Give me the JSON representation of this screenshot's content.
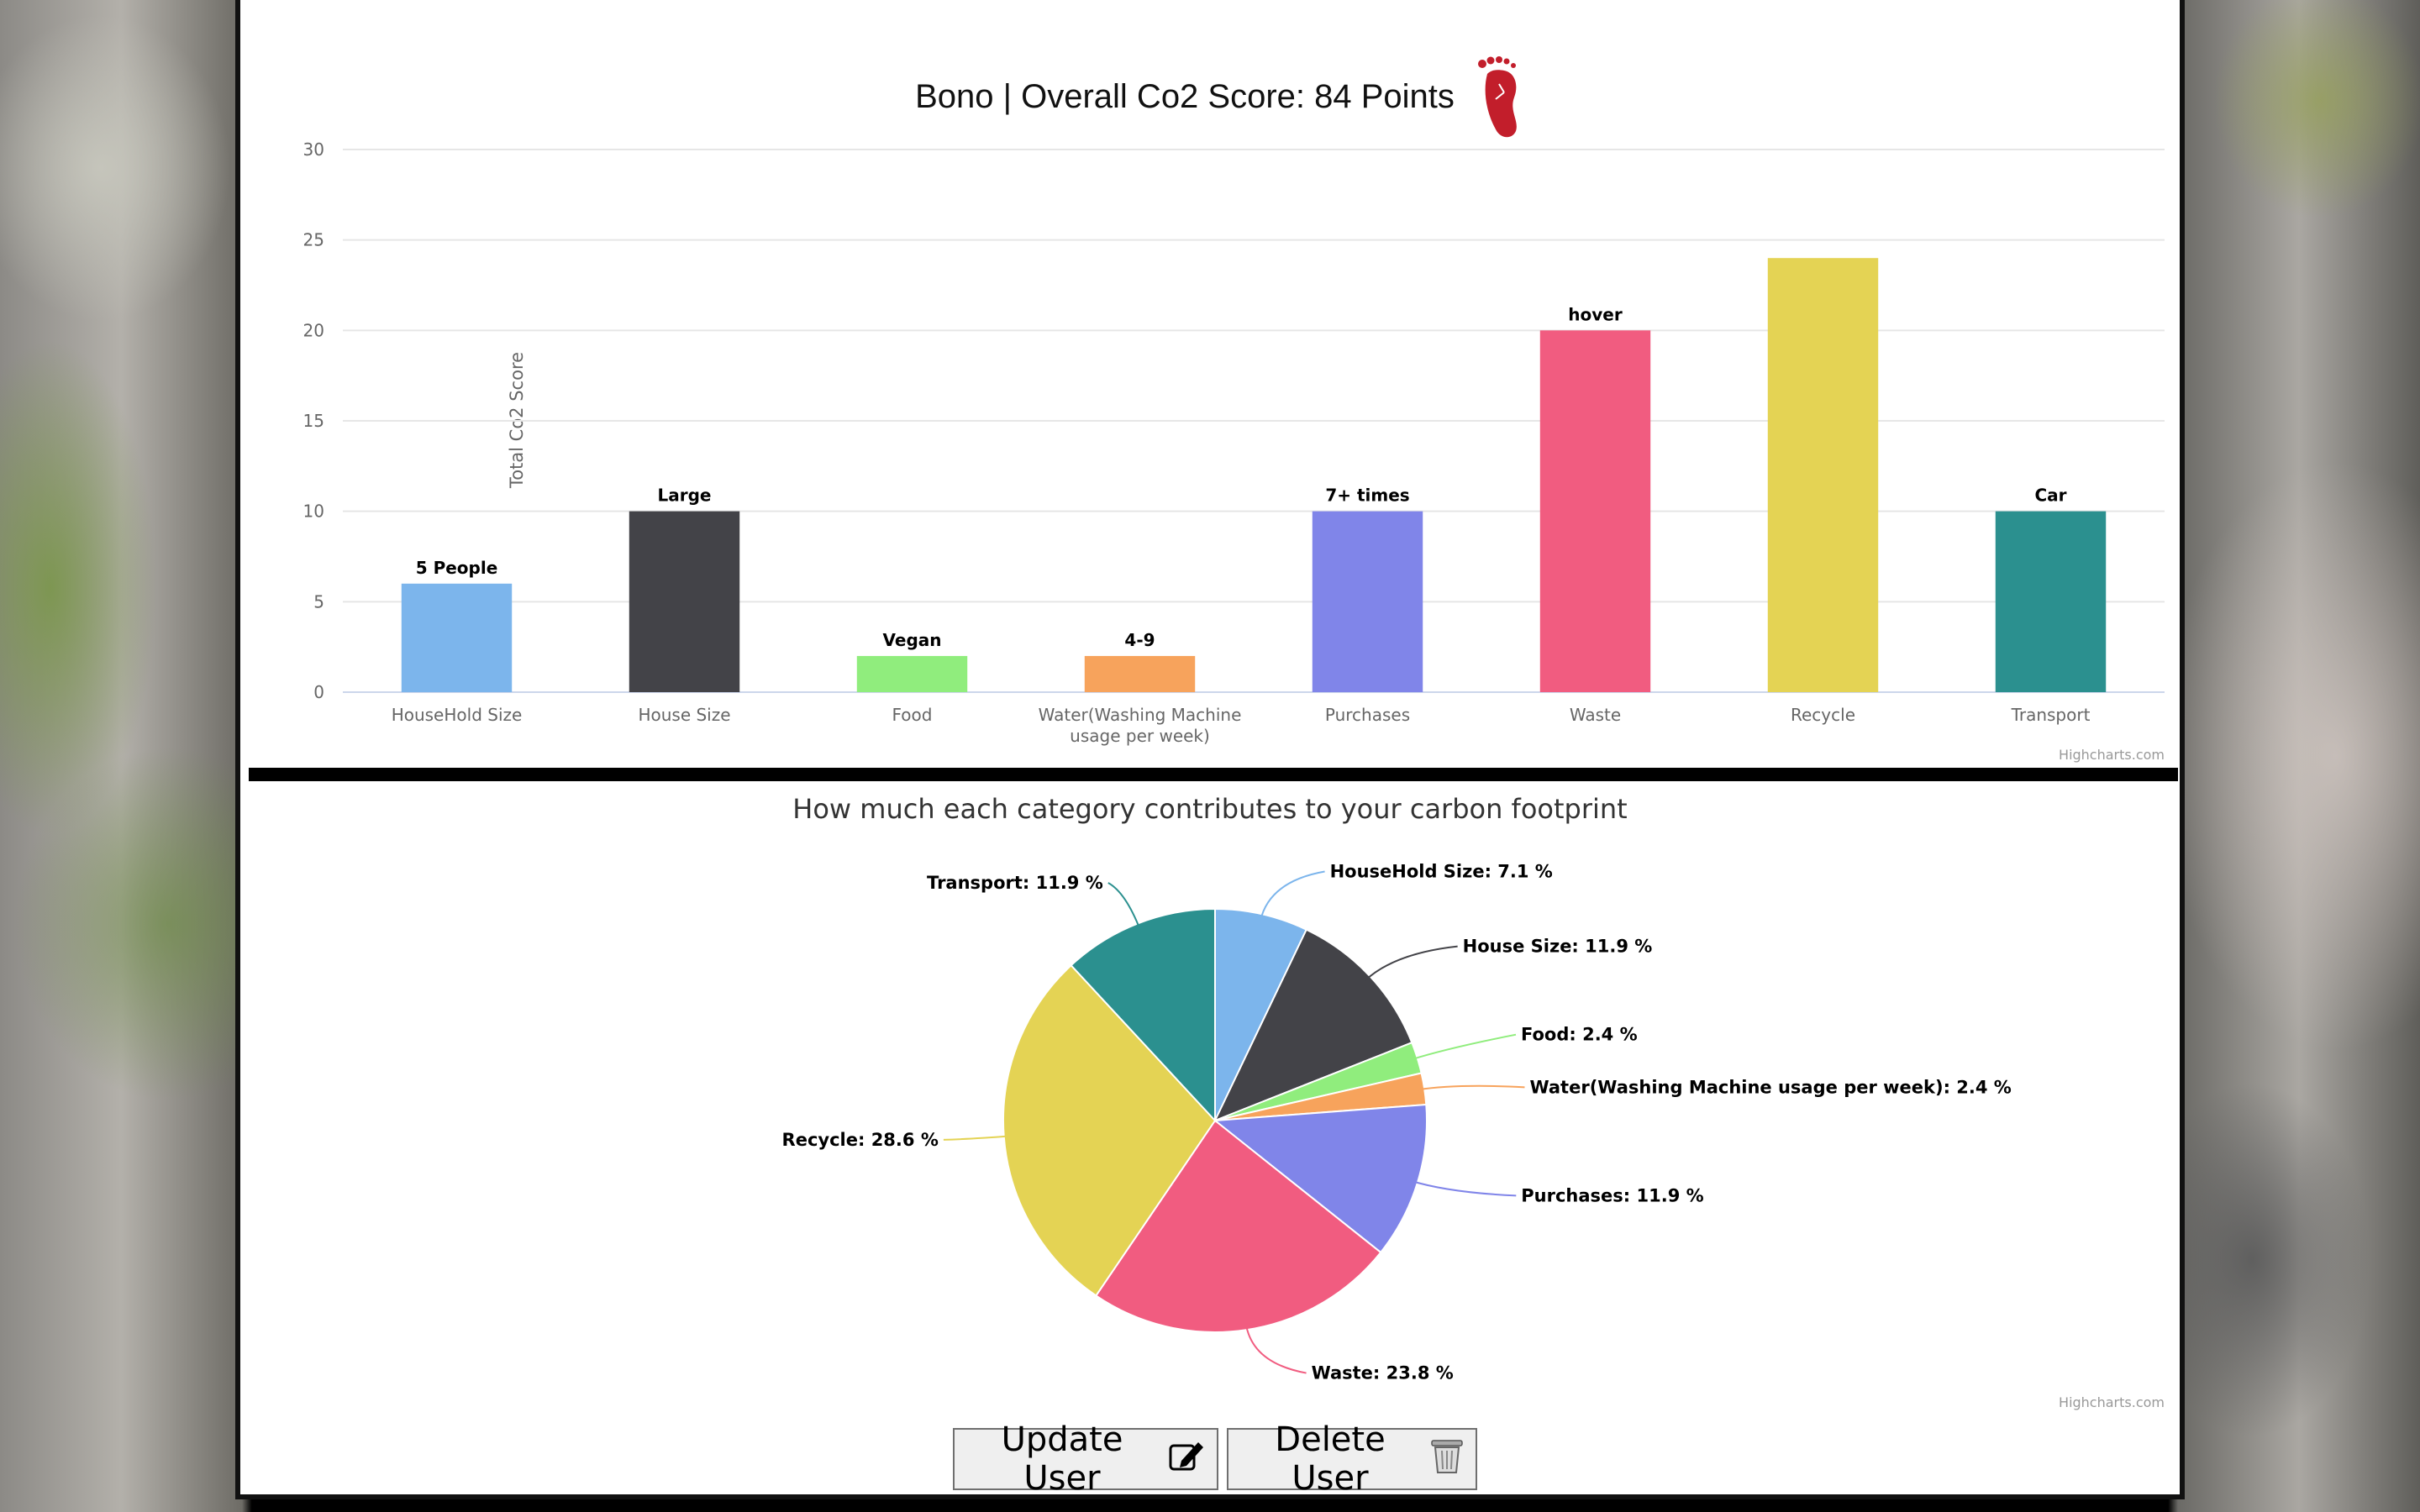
{
  "bar_chart": {
    "title": "Bono | Overall Co2 Score: 84 Points",
    "title_icon": "footprint-icon",
    "credits": "Highcharts.com"
  },
  "pie_chart": {
    "title": "How much each category contributes to your carbon footprint",
    "credits": "Highcharts.com"
  },
  "buttons": {
    "update_label": "Update User",
    "update_icon": "edit-icon",
    "delete_label": "Delete User",
    "delete_icon": "trash-icon"
  },
  "chart_data": [
    {
      "type": "bar",
      "title": "Bono | Overall Co2 Score: 84 Points",
      "ylabel": "Total Co2 Score",
      "ylim": [
        0,
        30
      ],
      "yticks": [
        "0",
        "5",
        "10",
        "15",
        "20",
        "25",
        "30"
      ],
      "grid": true,
      "legend": "none",
      "categories": [
        "HouseHold Size",
        "House Size",
        "Food",
        "Water(Washing Machine usage per week)",
        "Purchases",
        "Waste",
        "Recycle",
        "Transport"
      ],
      "values": [
        6,
        10,
        2,
        2,
        10,
        20,
        24,
        10
      ],
      "data_labels": [
        "5 People",
        "Large",
        "Vegan",
        "4-9",
        "7+ times",
        "hover",
        "",
        "Car"
      ],
      "colors": [
        "#7cb5ec",
        "#434348",
        "#90ed7d",
        "#f7a35c",
        "#8085e9",
        "#f15c80",
        "#e4d354",
        "#2b908f"
      ]
    },
    {
      "type": "pie",
      "title": "How much each category contributes to your carbon footprint",
      "legend": "none",
      "slices": [
        {
          "label": "HouseHold Size: 7.1 %",
          "value": 7.1,
          "color": "#7cb5ec"
        },
        {
          "label": "House Size: 11.9 %",
          "value": 11.9,
          "color": "#434348"
        },
        {
          "label": "Food: 2.4 %",
          "value": 2.4,
          "color": "#90ed7d"
        },
        {
          "label": "Water(Washing Machine usage per week): 2.4 %",
          "value": 2.4,
          "color": "#f7a35c"
        },
        {
          "label": "Purchases: 11.9 %",
          "value": 11.9,
          "color": "#8085e9"
        },
        {
          "label": "Waste: 23.8 %",
          "value": 23.8,
          "color": "#f15c80"
        },
        {
          "label": "Recycle: 28.6 %",
          "value": 28.6,
          "color": "#e4d354"
        },
        {
          "label": "Transport: 11.9 %",
          "value": 11.9,
          "color": "#2b908f"
        }
      ]
    }
  ]
}
